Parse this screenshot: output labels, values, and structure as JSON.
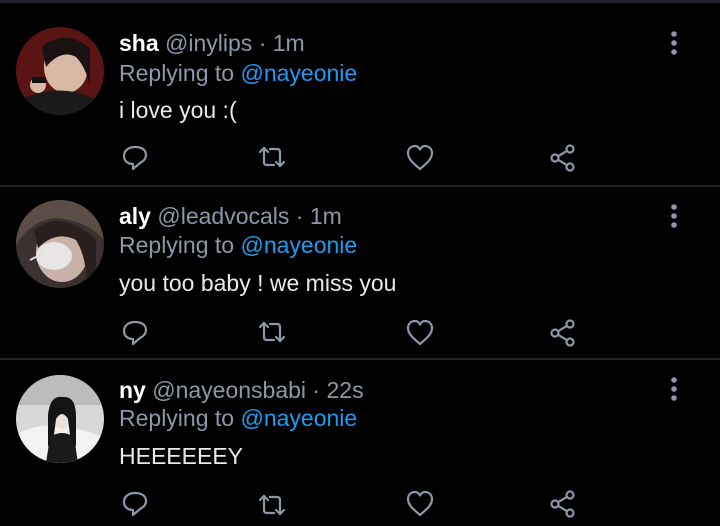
{
  "tweets": [
    {
      "name": "sha",
      "handle": "@inylips",
      "separator": "·",
      "time": "1m",
      "replying_prefix": "Replying to",
      "replying_to": "@nayeonie",
      "text": "i love you :(",
      "avatar_icon": "profile-photo-dark-red",
      "more_icon": "more-vertical-icon"
    },
    {
      "name": "aly",
      "handle": "@leadvocals",
      "separator": "·",
      "time": "1m",
      "replying_prefix": "Replying to",
      "replying_to": "@nayeonie",
      "text": "you too baby ! we miss you",
      "avatar_icon": "profile-photo-mask",
      "more_icon": "more-vertical-icon"
    },
    {
      "name": "ny",
      "handle": "@nayeonsbabi",
      "separator": "·",
      "time": "22s",
      "replying_prefix": "Replying to",
      "replying_to": "@nayeonie",
      "text": "HEEEEEEY",
      "avatar_icon": "profile-photo-monochrome",
      "more_icon": "more-vertical-icon"
    }
  ],
  "actions": [
    "reply-icon",
    "retweet-icon",
    "like-icon",
    "share-icon"
  ],
  "colors": {
    "background": "#000000",
    "divider": "#202327",
    "secondary_text": "#8b98a5",
    "primary_text": "#e7e9ea",
    "mention": "#1d9bf0",
    "icon": "#8b98a5"
  }
}
